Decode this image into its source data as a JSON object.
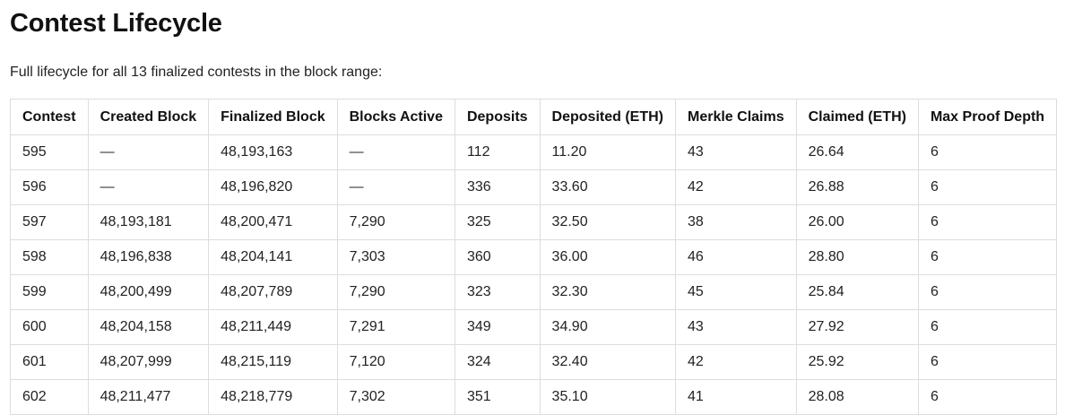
{
  "page": {
    "title": "Contest Lifecycle",
    "intro": "Full lifecycle for all 13 finalized contests in the block range:"
  },
  "table": {
    "headers": [
      "Contest",
      "Created Block",
      "Finalized Block",
      "Blocks Active",
      "Deposits",
      "Deposited (ETH)",
      "Merkle Claims",
      "Claimed (ETH)",
      "Max Proof Depth"
    ],
    "rows": [
      [
        "595",
        "—",
        "48,193,163",
        "—",
        "112",
        "11.20",
        "43",
        "26.64",
        "6"
      ],
      [
        "596",
        "—",
        "48,196,820",
        "—",
        "336",
        "33.60",
        "42",
        "26.88",
        "6"
      ],
      [
        "597",
        "48,193,181",
        "48,200,471",
        "7,290",
        "325",
        "32.50",
        "38",
        "26.00",
        "6"
      ],
      [
        "598",
        "48,196,838",
        "48,204,141",
        "7,303",
        "360",
        "36.00",
        "46",
        "28.80",
        "6"
      ],
      [
        "599",
        "48,200,499",
        "48,207,789",
        "7,290",
        "323",
        "32.30",
        "45",
        "25.84",
        "6"
      ],
      [
        "600",
        "48,204,158",
        "48,211,449",
        "7,291",
        "349",
        "34.90",
        "43",
        "27.92",
        "6"
      ],
      [
        "601",
        "48,207,999",
        "48,215,119",
        "7,120",
        "324",
        "32.40",
        "42",
        "25.92",
        "6"
      ],
      [
        "602",
        "48,211,477",
        "48,218,779",
        "7,302",
        "351",
        "35.10",
        "41",
        "28.08",
        "6"
      ]
    ]
  }
}
